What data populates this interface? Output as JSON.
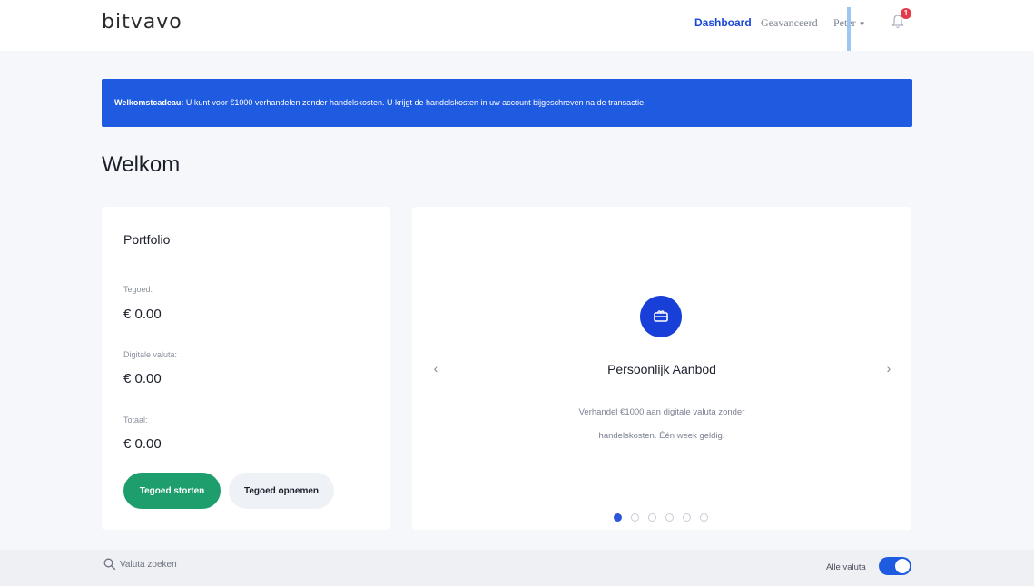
{
  "header": {
    "logo": "bitvavo",
    "nav": {
      "dashboard": "Dashboard",
      "advanced": "Geavanceerd",
      "user": "Peter"
    },
    "notification_count": "1"
  },
  "banner": {
    "bold": "Welkomstcadeau:",
    "text": " U kunt voor €1000 verhandelen zonder handelskosten. U krijgt de handelskosten in uw account bijgeschreven na de transactie."
  },
  "page_title": "Welkom",
  "portfolio": {
    "title": "Portfolio",
    "balance_label": "Tegoed:",
    "balance_value": "€ 0.00",
    "digital_label": "Digitale valuta:",
    "digital_value": "€ 0.00",
    "total_label": "Totaal:",
    "total_value": "€ 0.00",
    "deposit_button": "Tegoed storten",
    "withdraw_button": "Tegoed opnemen"
  },
  "offer": {
    "icon": "gift-card-icon",
    "title": "Persoonlijk Aanbod",
    "text_line1": "Verhandel €1000 aan digitale valuta zonder",
    "text_line2": "handelskosten. Één week geldig.",
    "prev_arrow": "‹",
    "next_arrow": "›",
    "slide_count": 6,
    "active_slide": 1
  },
  "bottom": {
    "search_placeholder": "Valuta zoeken",
    "toggle_label": "Alle valuta",
    "toggle_on": true
  },
  "colors": {
    "accent": "#1f5be0",
    "deposit": "#1e9e6d",
    "badge": "#e23b4b"
  }
}
